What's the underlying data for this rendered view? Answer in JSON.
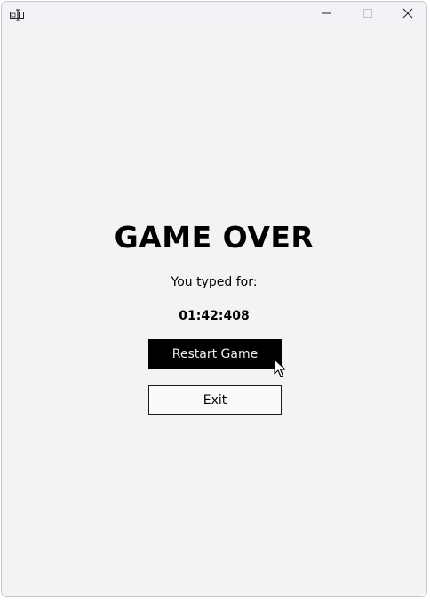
{
  "window": {
    "icon": "app-window-icon",
    "controls": {
      "minimize_icon": "minimize-icon",
      "maximize_icon": "maximize-icon",
      "close_icon": "close-icon"
    }
  },
  "main": {
    "heading": "GAME OVER",
    "typed_label": "You typed for:",
    "time": "01:42:408",
    "restart_label": "Restart Game",
    "exit_label": "Exit"
  },
  "colors": {
    "background": "#f3f3f3",
    "titlebar": "#f1f3f6",
    "primary_button": "#000000",
    "primary_button_text": "#f0f0f0"
  }
}
